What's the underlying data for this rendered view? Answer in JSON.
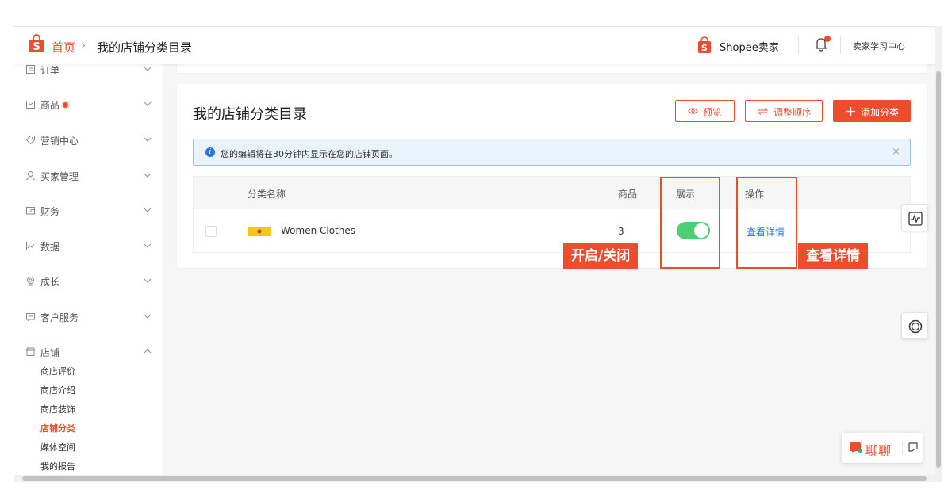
{
  "header": {
    "breadcrumb_home": "首页",
    "breadcrumb_separator": "›",
    "breadcrumb_current": "我的店铺分类目录",
    "brand_text": "Shopee卖家",
    "learning_center": "卖家学习中心"
  },
  "sidebar": {
    "items": [
      {
        "label": "订单",
        "icon": "order-icon",
        "expanded": false
      },
      {
        "label": "商品",
        "icon": "product-icon",
        "expanded": false,
        "badge": true
      },
      {
        "label": "营销中心",
        "icon": "tag-icon",
        "expanded": false
      },
      {
        "label": "买家管理",
        "icon": "user-icon",
        "expanded": false
      },
      {
        "label": "财务",
        "icon": "wallet-icon",
        "expanded": false
      },
      {
        "label": "数据",
        "icon": "chart-icon",
        "expanded": false
      },
      {
        "label": "成长",
        "icon": "growth-icon",
        "expanded": false
      },
      {
        "label": "客户服务",
        "icon": "service-icon",
        "expanded": false
      },
      {
        "label": "店铺",
        "icon": "shop-icon",
        "expanded": true
      }
    ],
    "shop_subitems": [
      "商店评价",
      "商店介绍",
      "商店装饰",
      "店铺分类",
      "媒体空间",
      "我的报告"
    ],
    "active_subitem": "店铺分类"
  },
  "main": {
    "title": "我的店铺分类目录",
    "buttons": {
      "preview": "预览",
      "reorder": "调整顺序",
      "add_category": "添加分类"
    },
    "info_banner": "您的编辑将在30分钟内显示在您的店铺页面。",
    "table": {
      "headers": {
        "name": "分类名称",
        "products": "商品",
        "display": "展示",
        "actions": "操作"
      },
      "rows": [
        {
          "name": "Women Clothes",
          "products": "3",
          "display_on": true,
          "action": "查看详情"
        }
      ]
    }
  },
  "annotations": {
    "toggle_label": "开启/关闭",
    "detail_label": "查看详情"
  },
  "chat": {
    "label": "聊聊"
  },
  "colors": {
    "brand": "#ee4d2d",
    "link": "#2673dd",
    "toggle_on": "#4cd071",
    "info_bg": "#eaf2fb"
  }
}
